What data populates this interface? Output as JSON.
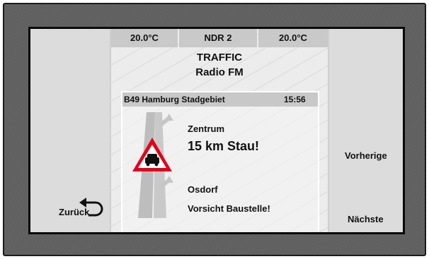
{
  "status_bar": {
    "temp_left": "20.0°C",
    "station": "NDR 2",
    "temp_right": "20.0°C"
  },
  "title": {
    "line1": "TRAFFIC",
    "line2": "Radio FM"
  },
  "message": {
    "road": "B49 Hamburg Stadgebiet",
    "time": "15:56",
    "direction": "Zentrum",
    "headline": "15 km Stau!",
    "exit": "Osdorf",
    "notice": "Vorsicht Baustelle!"
  },
  "buttons": {
    "back": "Zurück",
    "previous": "Vorherige",
    "next": "Nächste"
  },
  "icons": {
    "back": "return-arrow-icon",
    "warning": "traffic-jam-warning-icon",
    "road": "road-diagram-icon"
  },
  "colors": {
    "warning_red": "#e3001b",
    "bezel": "#5f5f5f"
  }
}
